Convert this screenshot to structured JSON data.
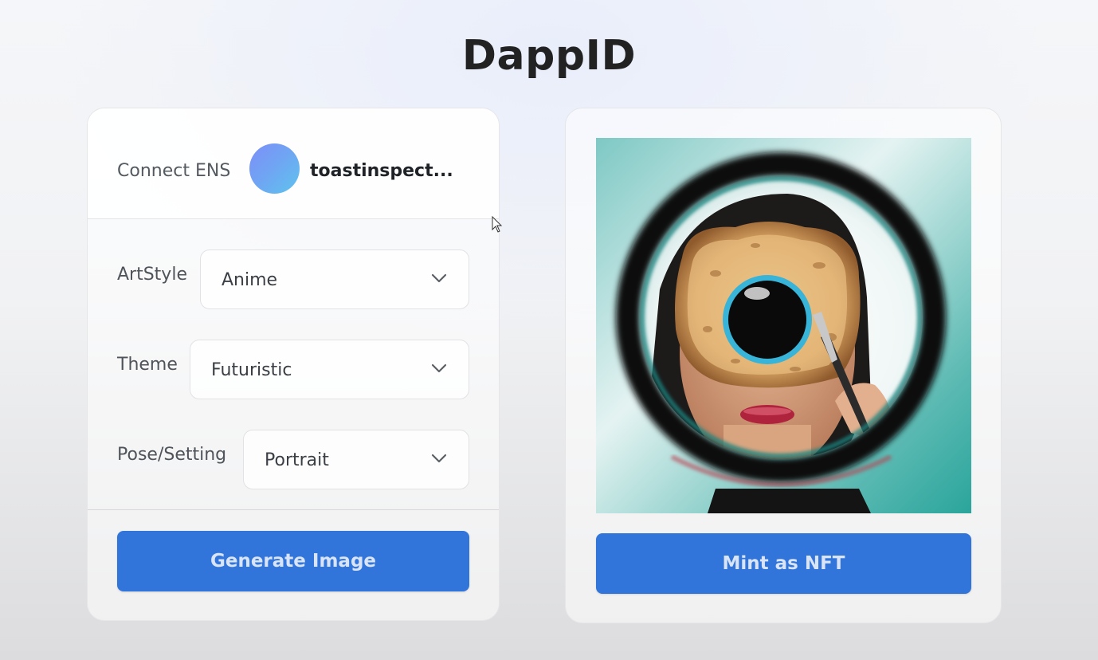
{
  "header": {
    "title": "DappID"
  },
  "ens": {
    "label": "Connect ENS",
    "name": "toastinspect..."
  },
  "fields": [
    {
      "label": "ArtStyle",
      "value": "Anime"
    },
    {
      "label": "Theme",
      "value": "Futuristic"
    },
    {
      "label": "Pose/Setting",
      "value": "Portrait"
    }
  ],
  "actions": {
    "generate_label": "Generate Image",
    "mint_label": "Mint as NFT"
  },
  "icons": {
    "avatar": "ens-avatar-gradient",
    "dropdown": "chevron-down-icon",
    "cursor": "mouse-pointer-icon"
  },
  "colors": {
    "accent": "#3275da",
    "button_text": "#d9e4f6",
    "title": "#222222"
  }
}
